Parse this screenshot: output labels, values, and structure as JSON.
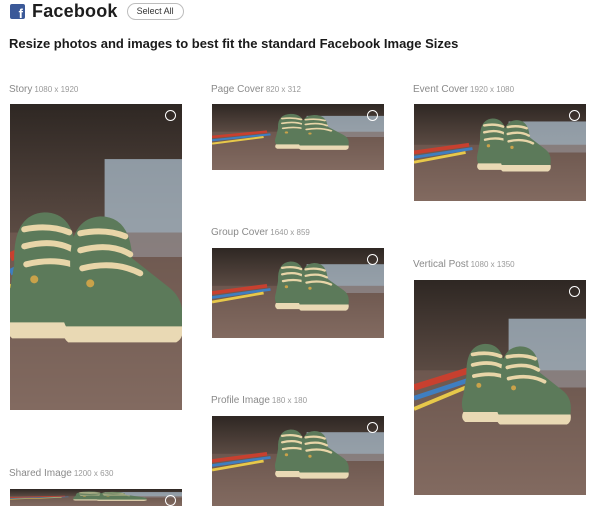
{
  "header": {
    "icon": "facebook-f-icon",
    "title": "Facebook",
    "select_all_label": "Select All"
  },
  "subtitle": "Resize photos and images to best fit the standard Facebook Image Sizes",
  "items": [
    {
      "name": "Story",
      "size": "1080 x 1920"
    },
    {
      "name": "Page Cover",
      "size": "820 x 312"
    },
    {
      "name": "Event Cover",
      "size": "1920 x 1080"
    },
    {
      "name": "Group Cover",
      "size": "1640 x 859"
    },
    {
      "name": "Vertical Post",
      "size": "1080 x 1350"
    },
    {
      "name": "Profile Image",
      "size": "180 x 180"
    },
    {
      "name": "Shared Image",
      "size": "1200 x 630"
    }
  ],
  "colors": {
    "brand": "#3b5998"
  }
}
